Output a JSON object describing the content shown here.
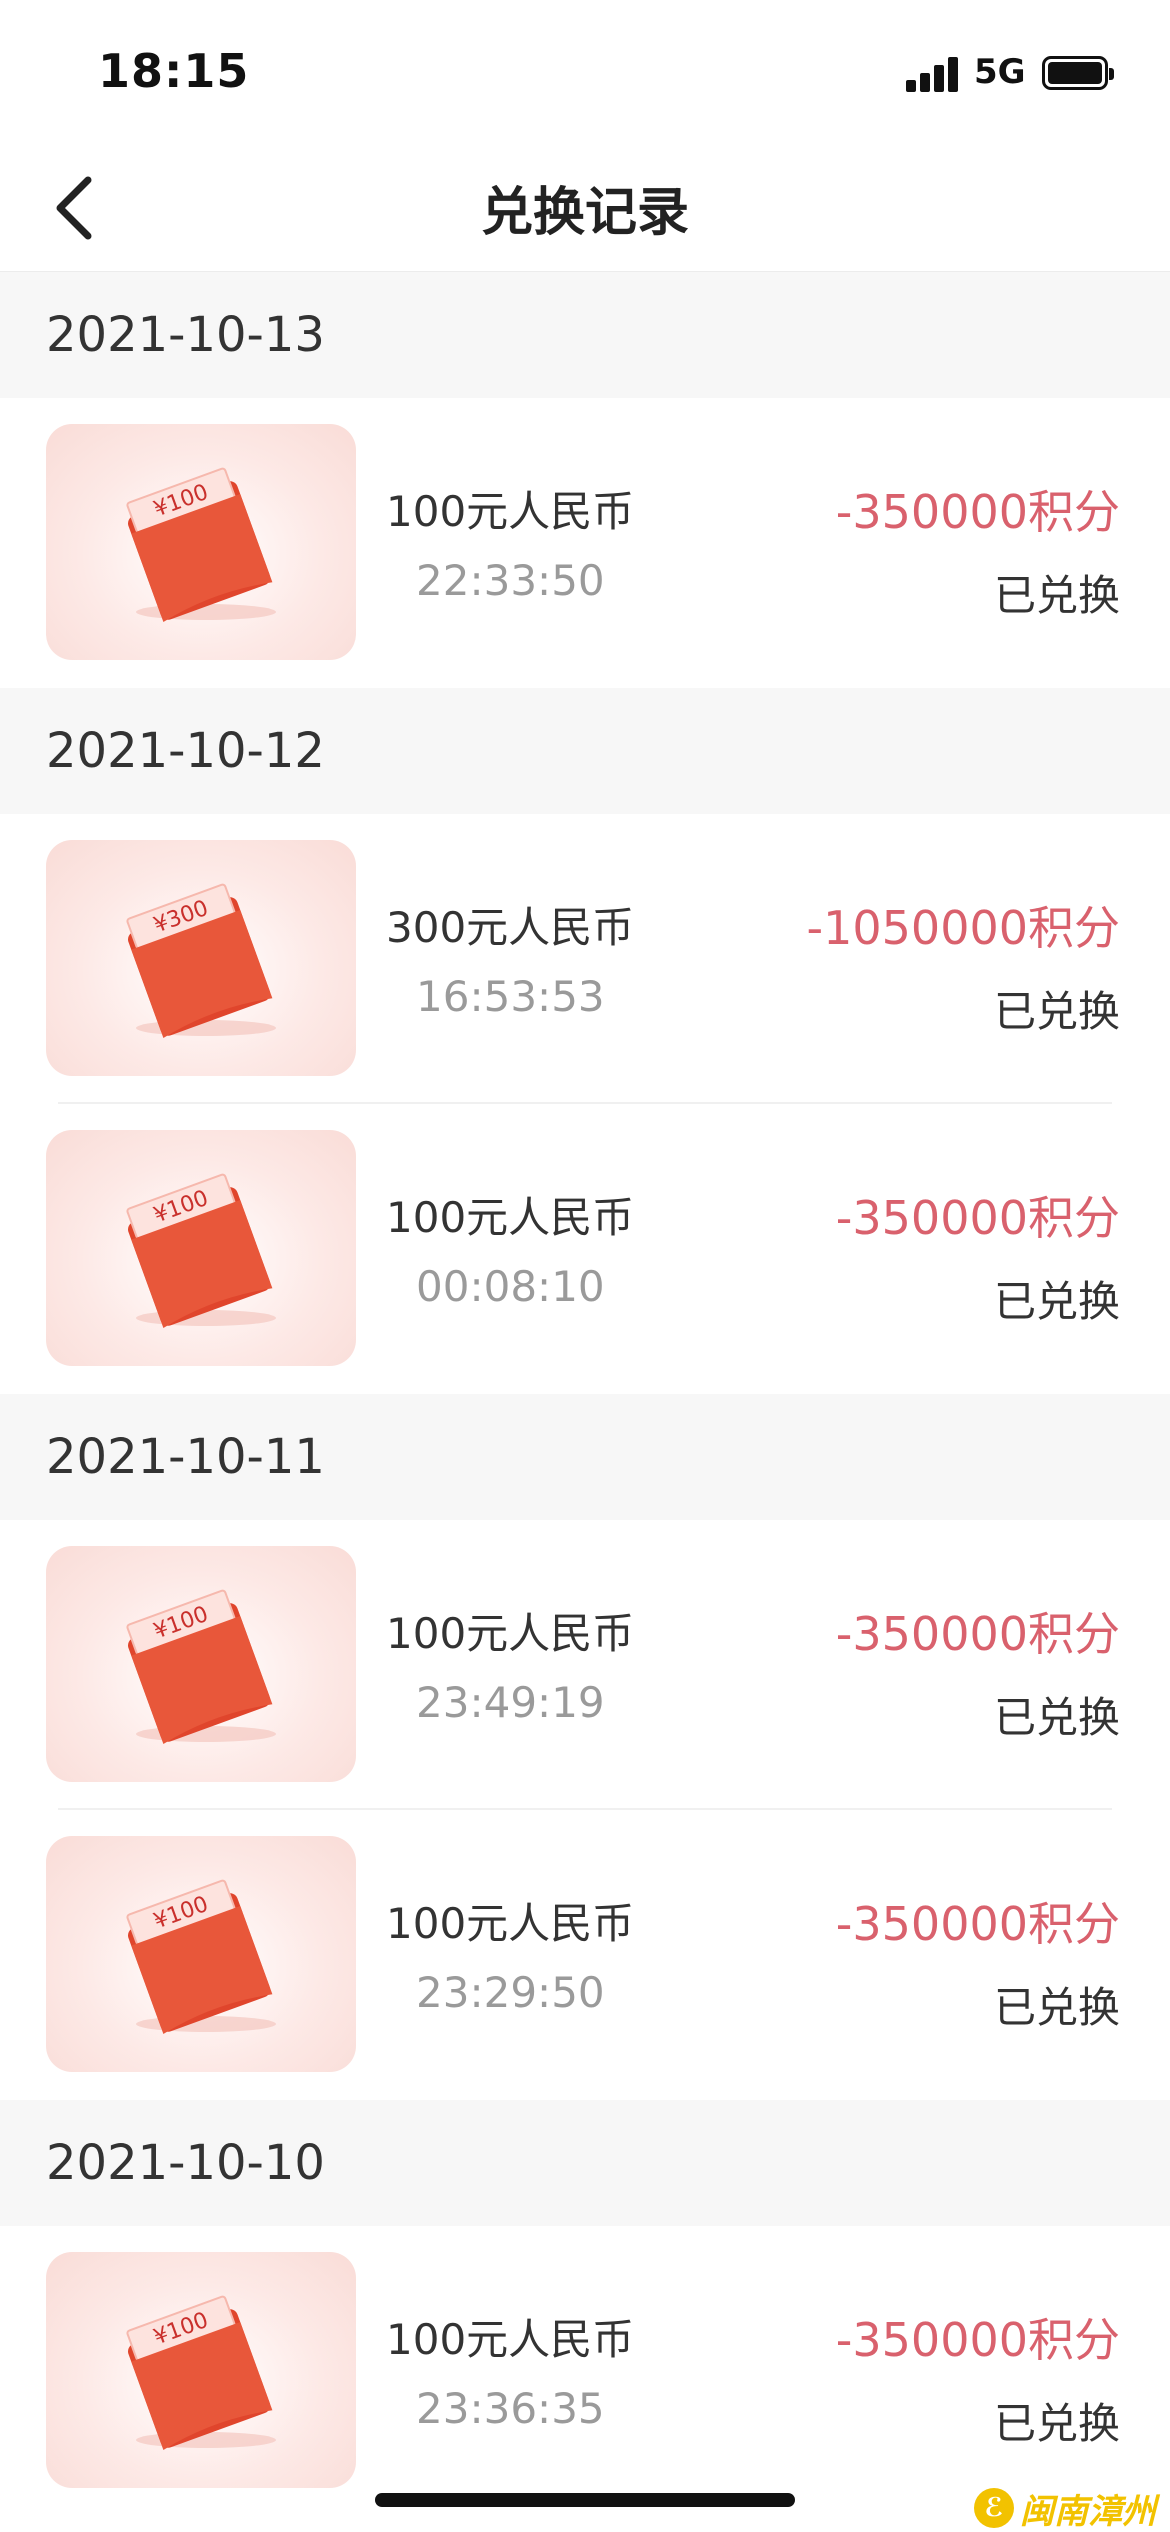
{
  "status_bar": {
    "time": "18:15",
    "network": "5G"
  },
  "nav": {
    "title": "兑换记录",
    "back_icon": "chevron-left-icon"
  },
  "groups": [
    {
      "date": "2021-10-13",
      "records": [
        {
          "name": "100元人民币",
          "time": "22:33:50",
          "points": "-350000积分",
          "status": "已兑换",
          "voucher": "¥100"
        }
      ]
    },
    {
      "date": "2021-10-12",
      "records": [
        {
          "name": "300元人民币",
          "time": "16:53:53",
          "points": "-1050000积分",
          "status": "已兑换",
          "voucher": "¥300"
        },
        {
          "name": "100元人民币",
          "time": "00:08:10",
          "points": "-350000积分",
          "status": "已兑换",
          "voucher": "¥100"
        }
      ]
    },
    {
      "date": "2021-10-11",
      "records": [
        {
          "name": "100元人民币",
          "time": "23:49:19",
          "points": "-350000积分",
          "status": "已兑换",
          "voucher": "¥100"
        },
        {
          "name": "100元人民币",
          "time": "23:29:50",
          "points": "-350000积分",
          "status": "已兑换",
          "voucher": "¥100"
        }
      ]
    },
    {
      "date": "2021-10-10",
      "records": [
        {
          "name": "100元人民币",
          "time": "23:36:35",
          "points": "-350000积分",
          "status": "已兑换",
          "voucher": "¥100"
        }
      ]
    }
  ],
  "watermark": {
    "text": "闽南漳州"
  },
  "colors": {
    "points": "#d9616d",
    "envelope": "#e85a3a",
    "date_header_bg": "#f7f7f7"
  }
}
